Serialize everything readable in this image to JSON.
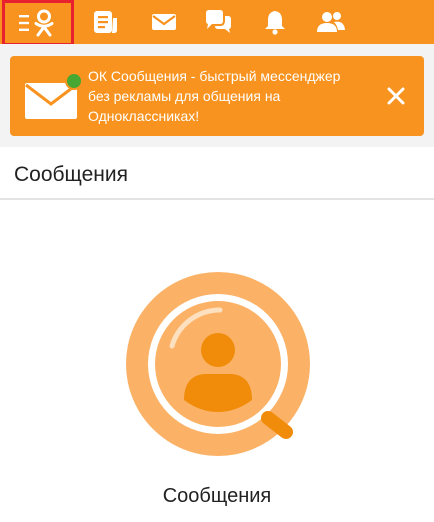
{
  "colors": {
    "accent": "#f7931e",
    "highlight_border": "#e8212f",
    "online_dot": "#46a832",
    "background_gray": "#f3f3f3"
  },
  "topbar": {
    "items": [
      {
        "name": "menu-ok-logo",
        "icon": "ok-logo-menu-icon"
      },
      {
        "name": "feed",
        "icon": "feed-icon"
      },
      {
        "name": "messages",
        "icon": "envelope-icon"
      },
      {
        "name": "discussions",
        "icon": "chat-bubbles-icon"
      },
      {
        "name": "notifications",
        "icon": "bell-icon"
      },
      {
        "name": "friends",
        "icon": "friends-icon"
      }
    ]
  },
  "banner": {
    "icon": "envelope-icon",
    "line1": "ОК Сообщения - быстрый мессенджер",
    "line2": "без рекламы для общения на",
    "line3": "Одноклассниках!",
    "close_icon": "close-icon"
  },
  "page": {
    "title": "Сообщения"
  },
  "empty_state": {
    "icon": "search-user-icon",
    "caption": "Сообщения"
  }
}
